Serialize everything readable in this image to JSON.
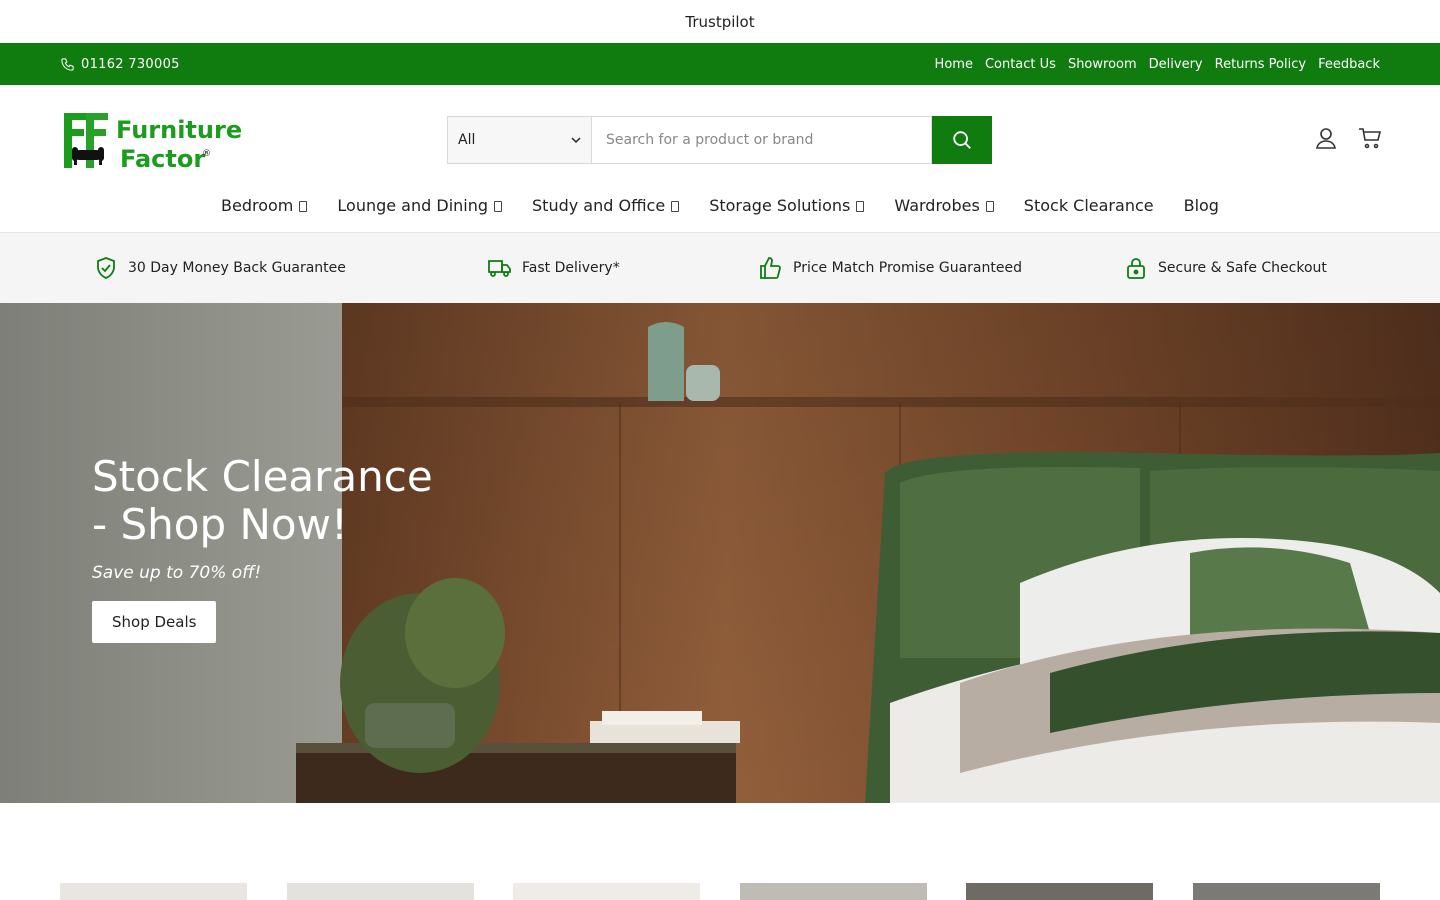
{
  "trust_bar": {
    "text": "Trustpilot"
  },
  "top_bar": {
    "phone": "01162 730005",
    "links": [
      "Home",
      "Contact Us",
      "Showroom",
      "Delivery",
      "Returns Policy",
      "Feedback"
    ]
  },
  "header": {
    "logo_text_line1": "Furniture",
    "logo_text_line2": "Factor",
    "search": {
      "category": "All",
      "placeholder": "Search for a product or brand"
    }
  },
  "nav": {
    "items": [
      {
        "label": "Bedroom",
        "has_dropdown": true
      },
      {
        "label": "Lounge and Dining",
        "has_dropdown": true
      },
      {
        "label": "Study and Office",
        "has_dropdown": true
      },
      {
        "label": "Storage Solutions",
        "has_dropdown": true
      },
      {
        "label": "Wardrobes",
        "has_dropdown": true
      },
      {
        "label": "Stock Clearance",
        "has_dropdown": false
      },
      {
        "label": "Blog",
        "has_dropdown": false
      }
    ]
  },
  "features": [
    {
      "icon": "shield-check-icon",
      "label": "30 Day Money Back Guarantee"
    },
    {
      "icon": "truck-icon",
      "label": "Fast Delivery*"
    },
    {
      "icon": "thumbs-up-icon",
      "label": "Price Match Promise Guaranteed"
    },
    {
      "icon": "lock-icon",
      "label": "Secure & Safe Checkout"
    }
  ],
  "hero": {
    "title": "Stock Clearance - Shop Now!",
    "subtitle": "Save up to 70% off!",
    "button": "Shop Deals"
  },
  "colors": {
    "brand_green": "#107c10",
    "logo_green": "#1c9c1c"
  }
}
